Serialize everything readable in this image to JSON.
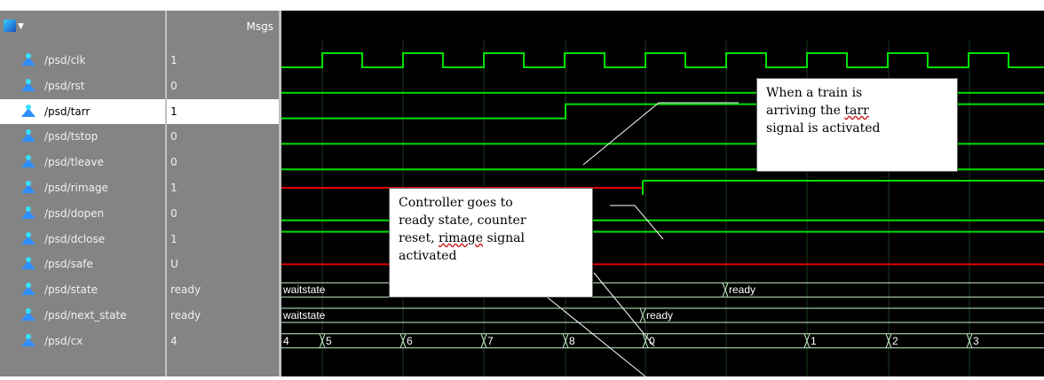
{
  "header": {
    "msgs_label": "Msgs",
    "menu_icon": "wave-menu-icon"
  },
  "signals": [
    {
      "name": "/psd/clk",
      "value": "1"
    },
    {
      "name": "/psd/rst",
      "value": "0"
    },
    {
      "name": "/psd/tarr",
      "value": "1"
    },
    {
      "name": "/psd/tstop",
      "value": "0"
    },
    {
      "name": "/psd/tleave",
      "value": "0"
    },
    {
      "name": "/psd/rimage",
      "value": "1"
    },
    {
      "name": "/psd/dopen",
      "value": "0"
    },
    {
      "name": "/psd/dclose",
      "value": "1"
    },
    {
      "name": "/psd/safe",
      "value": "U"
    },
    {
      "name": "/psd/state",
      "value": "ready"
    },
    {
      "name": "/psd/next_state",
      "value": "ready"
    },
    {
      "name": "/psd/cx",
      "value": "4"
    }
  ],
  "selected_signal": 2,
  "bus_labels": {
    "state": [
      "waitstate",
      "ready"
    ],
    "next_state": [
      "waitstate",
      "ready"
    ],
    "cx": [
      "4",
      "5",
      "6",
      "7",
      "8",
      "0",
      "1",
      "2",
      "3"
    ]
  },
  "colors": {
    "trace": "#00e000",
    "undefined": "#e00000",
    "bus": "#c8f0c8"
  },
  "annotations": {
    "train": [
      "When a train is",
      "arriving the tarr",
      "signal is activated"
    ],
    "controller": [
      "Controller goes to",
      "ready state, counter",
      "reset, rimage signal",
      "activated"
    ]
  }
}
